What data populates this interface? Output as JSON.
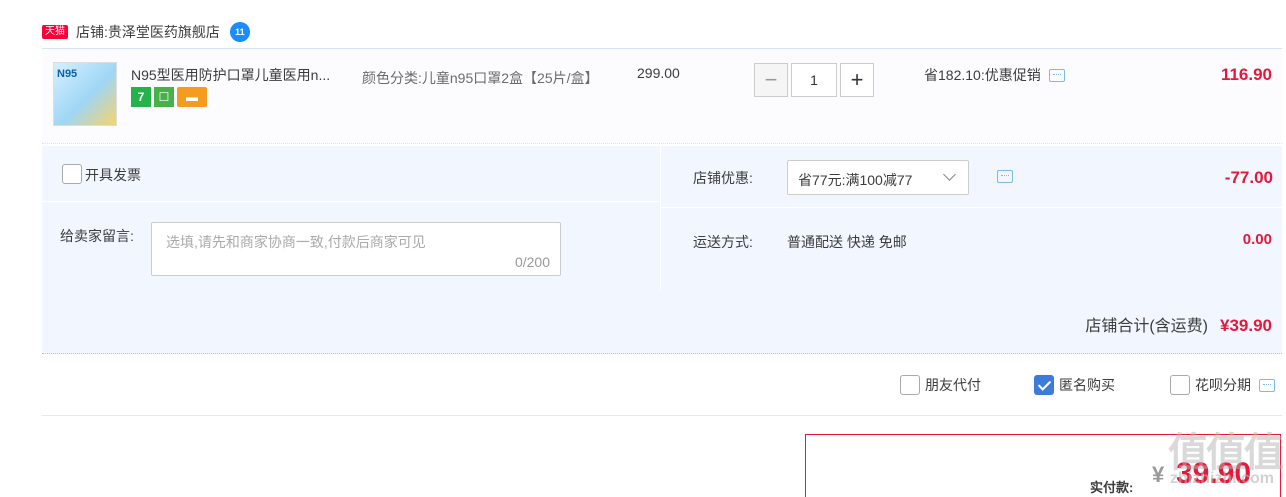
{
  "shop": {
    "badge": "天猫",
    "label": "店铺:",
    "name": "贵泽堂医药旗舰店",
    "chat_badge": "11"
  },
  "item": {
    "thumb_text": "N95",
    "title": "N95型医用防护口罩儿童医用n...",
    "badge_seven": "7",
    "sku": "颜色分类:儿童n95口罩2盒【25片/盒】",
    "unit_price": "299.00",
    "quantity": "1",
    "minus": "−",
    "plus": "+",
    "promo": "省182.10:优惠促销",
    "total": "116.90"
  },
  "options": {
    "invoice_label": "开具发票",
    "message_label": "给卖家留言:",
    "message_placeholder": "选填,请先和商家协商一致,付款后商家可见",
    "message_count": "0/200",
    "shop_discount_label": "店铺优惠:",
    "shop_discount_selected": "省77元:满100减77",
    "shop_discount_value": "-77.00",
    "shipping_label": "运送方式:",
    "shipping_method": "普通配送 快递 免邮",
    "shipping_value": "0.00",
    "shop_total_label": "店铺合计(含运费)",
    "shop_total_value": "¥39.90"
  },
  "payment": {
    "friend_pay": "朋友代付",
    "anonymous": "匿名购买",
    "huabei": "花呗分期"
  },
  "checkout": {
    "actual_label": "实付款:",
    "currency": "¥",
    "actual_value": "39.90"
  },
  "watermark": {
    "main": "值值值",
    "sub": "zhizhizhi.com"
  },
  "colors": {
    "price_red": "#e5173a",
    "checkbox_blue": "#3d7bd9",
    "panel_bg": "#f2f7ff"
  }
}
